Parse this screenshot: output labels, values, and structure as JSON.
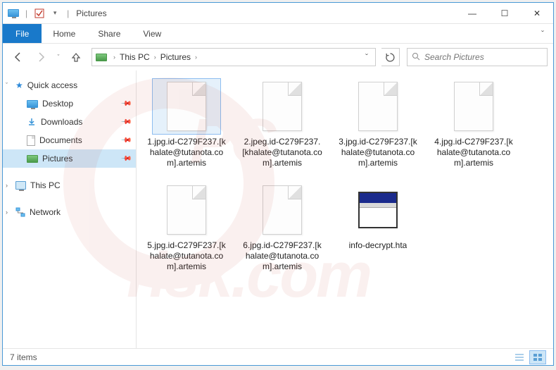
{
  "title": {
    "label": "Pictures",
    "sep": "|"
  },
  "window_buttons": {
    "min": "—",
    "max": "☐",
    "close": "✕"
  },
  "ribbon": {
    "file": "File",
    "tabs": [
      "Home",
      "Share",
      "View"
    ],
    "expand": "ˇ"
  },
  "nav": {
    "back": "←",
    "forward": "→",
    "recent": "ˇ",
    "up": "↑",
    "drop": "ˇ",
    "refresh": "↻"
  },
  "breadcrumb": {
    "parts": [
      "This PC",
      "Pictures"
    ],
    "sep": "›"
  },
  "search": {
    "placeholder": "Search Pictures",
    "icon": "🔍"
  },
  "sidebar": {
    "quick": {
      "label": "Quick access",
      "exp": "ˇ",
      "items": [
        {
          "label": "Desktop",
          "pinned": true,
          "icon": "monitor"
        },
        {
          "label": "Downloads",
          "pinned": true,
          "icon": "download"
        },
        {
          "label": "Documents",
          "pinned": true,
          "icon": "document"
        },
        {
          "label": "Pictures",
          "pinned": true,
          "icon": "picture",
          "selected": true
        }
      ]
    },
    "thispc": {
      "label": "This PC",
      "exp": "›"
    },
    "network": {
      "label": "Network",
      "exp": "›"
    }
  },
  "files": [
    {
      "name": "1.jpg.id-C279F237.[khalate@tutanota.com].artemis",
      "type": "blank",
      "selected": true
    },
    {
      "name": "2.jpeg.id-C279F237.[khalate@tutanota.com].artemis",
      "type": "blank"
    },
    {
      "name": "3.jpg.id-C279F237.[khalate@tutanota.com].artemis",
      "type": "blank"
    },
    {
      "name": "4.jpg.id-C279F237.[khalate@tutanota.com].artemis",
      "type": "blank"
    },
    {
      "name": "5.jpg.id-C279F237.[khalate@tutanota.com].artemis",
      "type": "blank"
    },
    {
      "name": "6.jpg.id-C279F237.[khalate@tutanota.com].artemis",
      "type": "blank"
    },
    {
      "name": "info-decrypt.hta",
      "type": "hta"
    }
  ],
  "status": {
    "count": "7 items"
  },
  "watermark": {
    "top": "PC",
    "bottom": "risk.com"
  }
}
